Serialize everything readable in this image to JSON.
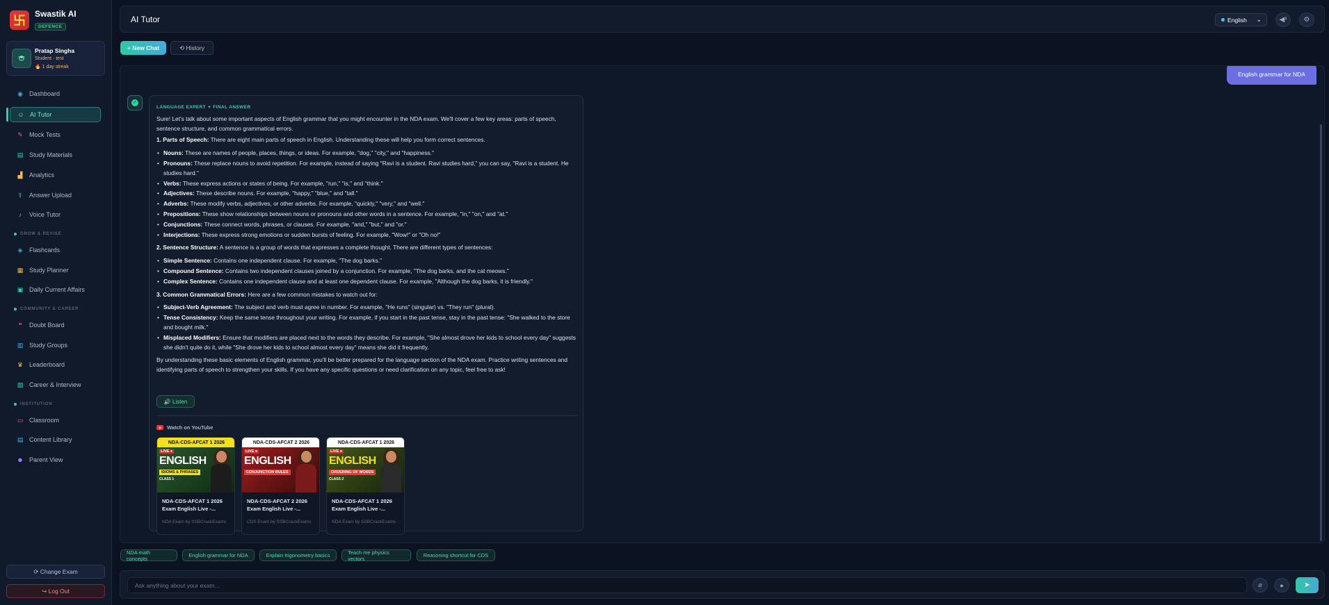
{
  "brand": {
    "name": "Swastik AI",
    "badge": "DEFENCE",
    "logo_glyph": "卐"
  },
  "user": {
    "name": "Pratap Singha",
    "role": "Student · test",
    "streak": "🔥 1 day streak"
  },
  "nav": {
    "dashboard": "Dashboard",
    "ai_tutor": "AI Tutor",
    "mock_tests": "Mock Tests",
    "study_materials": "Study Materials",
    "analytics": "Analytics",
    "answer_upload": "Answer Upload",
    "voice_tutor": "Voice Tutor",
    "section_grow": "GROW & REVISE",
    "flashcards": "Flashcards",
    "study_planner": "Study Planner",
    "daily_current_affairs": "Daily Current Affairs",
    "section_community": "COMMUNITY & CAREER",
    "doubt_board": "Doubt Board",
    "study_groups": "Study Groups",
    "leaderboard": "Leaderboard",
    "career_interview": "Career & Interview",
    "section_institution": "INSTITUTION",
    "classroom": "Classroom",
    "content_library": "Content Library",
    "parent_view": "Parent View"
  },
  "sidebar_footer": {
    "change_exam": "⟳ Change Exam",
    "logout": "↪ Log Out"
  },
  "header": {
    "title": "AI Tutor",
    "language": "English"
  },
  "toolbar": {
    "new_chat": "+ New Chat",
    "history": "⟲ History"
  },
  "chat": {
    "user_message": "English grammar for NDA",
    "answer_tag": "LANGUAGE EXPERT ✦ FINAL ANSWER",
    "intro": "Sure! Let's talk about some important aspects of English grammar that you might encounter in the NDA exam. We'll cover a few key areas: parts of speech, sentence structure, and common grammatical errors.",
    "s1_head": "1. Parts of Speech:",
    "s1_text": " There are eight main parts of speech in English. Understanding these will help you form correct sentences.",
    "s1_items": [
      {
        "term": "Nouns:",
        "text": " These are names of people, places, things, or ideas. For example, \"dog,\" \"city,\" and \"happiness.\""
      },
      {
        "term": "Pronouns:",
        "text": " These replace nouns to avoid repetition. For example, instead of saying \"Ravi is a student. Ravi studies hard,\" you can say, \"Ravi is a student. He studies hard.\""
      },
      {
        "term": "Verbs:",
        "text": " These express actions or states of being. For example, \"run,\" \"is,\" and \"think.\""
      },
      {
        "term": "Adjectives:",
        "text": " These describe nouns. For example, \"happy,\" \"blue,\" and \"tall.\""
      },
      {
        "term": "Adverbs:",
        "text": " These modify verbs, adjectives, or other adverbs. For example, \"quickly,\" \"very,\" and \"well.\""
      },
      {
        "term": "Prepositions:",
        "text": " These show relationships between nouns or pronouns and other words in a sentence. For example, \"in,\" \"on,\" and \"at.\""
      },
      {
        "term": "Conjunctions:",
        "text": " These connect words, phrases, or clauses. For example, \"and,\" \"but,\" and \"or.\""
      },
      {
        "term": "Interjections:",
        "text": " These express strong emotions or sudden bursts of feeling. For example, \"Wow!\" or \"Oh no!\""
      }
    ],
    "s2_head": "2. Sentence Structure:",
    "s2_text": " A sentence is a group of words that expresses a complete thought. There are different types of sentences:",
    "s2_items": [
      {
        "term": "Simple Sentence:",
        "text": " Contains one independent clause. For example, \"The dog barks.\""
      },
      {
        "term": "Compound Sentence:",
        "text": " Contains two independent clauses joined by a conjunction. For example, \"The dog barks, and the cat meows.\""
      },
      {
        "term": "Complex Sentence:",
        "text": " Contains one independent clause and at least one dependent clause. For example, \"Although the dog barks, it is friendly.\""
      }
    ],
    "s3_head": "3. Common Grammatical Errors:",
    "s3_text": " Here are a few common mistakes to watch out for:",
    "s3_items": [
      {
        "term": "Subject-Verb Agreement:",
        "text": " The subject and verb must agree in number. For example, \"He runs\" (singular) vs. \"They run\" (plural)."
      },
      {
        "term": "Tense Consistency:",
        "text": " Keep the same tense throughout your writing. For example, if you start in the past tense, stay in the past tense: \"She walked to the store and bought milk.\""
      },
      {
        "term": "Misplaced Modifiers:",
        "text": " Ensure that modifiers are placed next to the words they describe. For example, \"She almost drove her kids to school every day\" suggests she didn't quite do it, while \"She drove her kids to school almost every day\" means she did it frequently."
      }
    ],
    "outro": "By understanding these basic elements of English grammar, you'll be better prepared for the language section of the NDA exam. Practice writing sentences and identifying parts of speech to strengthen your skills. If you have any specific questions or need clarification on any topic, feel free to ask!",
    "listen": "🔊 Listen",
    "youtube_label": "Watch on YouTube"
  },
  "videos": [
    {
      "banner": "NDA-CDS-AFCAT 1 2026",
      "live": "LIVE ●",
      "big": "ENGLISH",
      "sub": "IDIOMS & PHRASES",
      "class": "CLASS 1",
      "title": "NDA-CDS-AFCAT 1 2026 Exam English Live -...",
      "channel": "NDA Exam by SSBCrackExams",
      "banner_color": "#f5e11b",
      "sub_color": "#f5e11b",
      "bg": "#1d4a2a"
    },
    {
      "banner": "NDA-CDS-AFCAT 2 2026",
      "live": "LIVE ●",
      "big": "ENGLISH",
      "sub": "CONJUNCTION RULES",
      "class": "",
      "title": "NDA-CDS-AFCAT 2 2026 Exam English Live -...",
      "channel": "CDS Exam by SSBCrackExams",
      "banner_color": "#ffffff",
      "sub_color": "#e53935",
      "bg": "#8e1c1c"
    },
    {
      "banner": "NDA-CDS-AFCAT 1 2026",
      "live": "LIVE ●",
      "big": "ENGLISH",
      "sub": "ORDERING OF WORDS",
      "class": "CLASS 2",
      "title": "NDA-CDS-AFCAT 1 2026 Exam English Live -...",
      "channel": "NDA Exam by SSBCrackExams",
      "banner_color": "#ffffff",
      "sub_color": "#e53935",
      "bg": "#2f4a22"
    }
  ],
  "suggestions": [
    "NDA math concepts",
    "English grammar for NDA",
    "Explain trigonometry basics",
    "Teach me physics vectors",
    "Reasoning shortcut for CDS"
  ],
  "input": {
    "placeholder": "Ask anything about your exam...",
    "value": ""
  },
  "colors": {
    "accent": "#2fd3a5",
    "user_bubble": "#6a6ee0",
    "background": "#0b1322"
  }
}
